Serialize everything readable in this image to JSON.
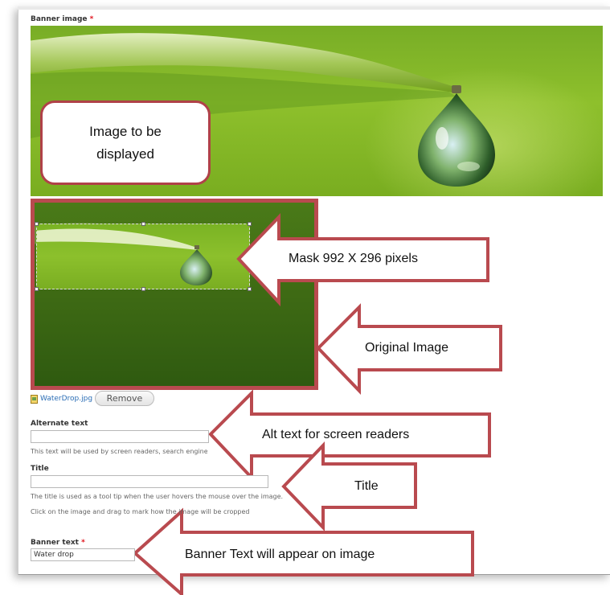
{
  "form": {
    "banner_image_label": "Banner image",
    "required_mark": "*",
    "file": {
      "name": "WaterDrop.jpg",
      "remove_label": "Remove"
    },
    "alternate_text": {
      "label": "Alternate text",
      "value": "",
      "help": "This text will be used by screen readers, search engines, or when the image cannot be loaded."
    },
    "title": {
      "label": "Title",
      "value": "",
      "help": "The title is used as a tool tip when the user hovers the mouse over the image."
    },
    "crop_help": "Click on the image and drag to mark how the image will be cropped",
    "banner_text": {
      "label": "Banner text",
      "value": "Water drop"
    }
  },
  "annotations": {
    "image_displayed": "Image to be displayed",
    "mask": "Mask 992 X 296 pixels",
    "original": "Original Image",
    "alt_text": "Alt text for screen readers",
    "title": "Title",
    "banner_text": "Banner Text will appear on image"
  },
  "colors": {
    "annotation_red": "#b94a4f",
    "leaf_green": "#8ec02c",
    "link_blue": "#2a6db5",
    "required_red": "#e0121b"
  }
}
